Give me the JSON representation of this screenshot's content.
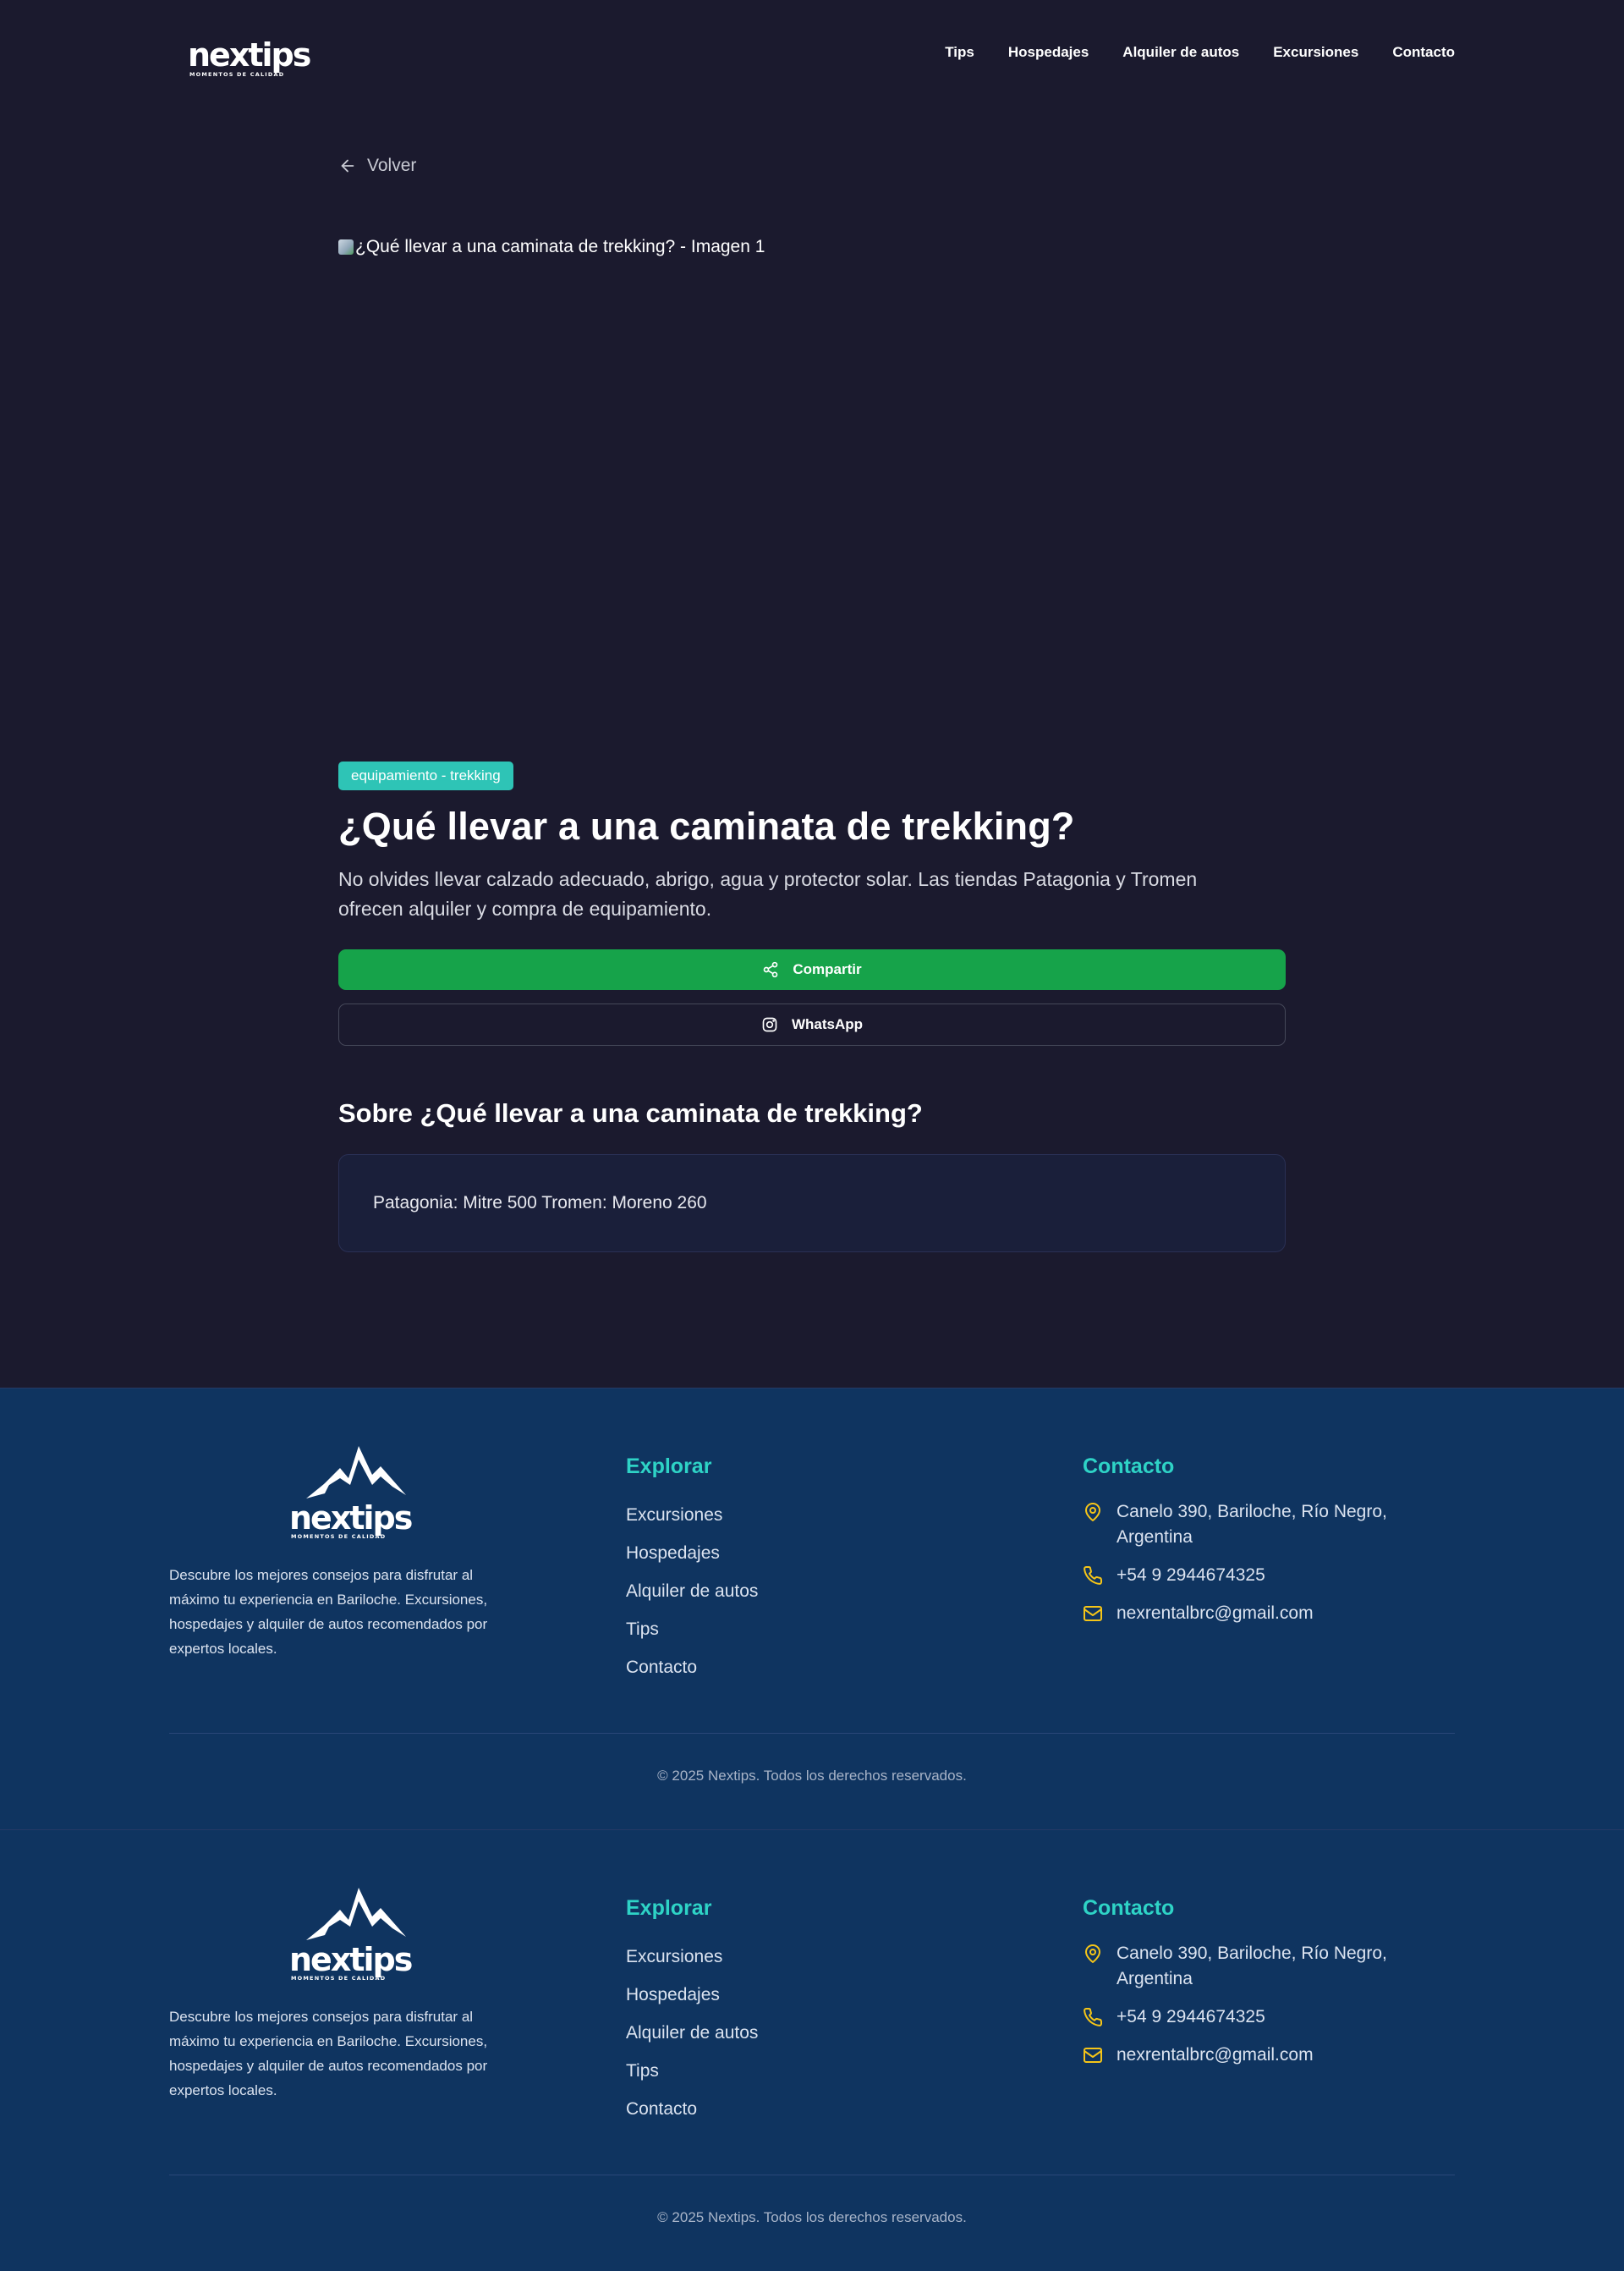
{
  "header": {
    "logo_alt": "nextips",
    "nav": [
      "Tips",
      "Hospedajes",
      "Alquiler de autos",
      "Excursiones",
      "Contacto"
    ]
  },
  "main": {
    "back_label": "Volver",
    "image_alt": "¿Qué llevar a una caminata de trekking? - Imagen 1",
    "tag": "equipamiento - trekking",
    "title": "¿Qué llevar a una caminata de trekking?",
    "description": "No olvides llevar calzado adecuado, abrigo, agua y protector solar. Las tiendas Patagonia y Tromen ofrecen alquiler y compra de equipamiento.",
    "share_label": "Compartir",
    "whatsapp_label": "WhatsApp",
    "about_title": "Sobre ¿Qué llevar a una caminata de trekking?",
    "about_text": "Patagonia: Mitre 500 Tromen: Moreno 260"
  },
  "footer": {
    "description": "Descubre los mejores consejos para disfrutar al máximo tu experiencia en Bariloche. Excursiones, hospedajes y alquiler de autos recomendados por expertos locales.",
    "explore_title": "Explorar",
    "explore_links": [
      "Excursiones",
      "Hospedajes",
      "Alquiler de autos",
      "Tips",
      "Contacto"
    ],
    "contact_title": "Contacto",
    "address": "Canelo 390, Bariloche, Río Negro, Argentina",
    "phone": "+54 9 2944674325",
    "email": "nexrentalbrc@gmail.com",
    "copyright": "© 2025 Nextips. Todos los derechos reservados."
  },
  "colors": {
    "background": "#1b1a2e",
    "footer": "#0f3460",
    "accent": "#2ec4b6",
    "share_green": "#16a34a",
    "icon_yellow": "#f5c518"
  },
  "icons": [
    "arrow-left-icon",
    "share-icon",
    "instagram-icon",
    "map-pin-icon",
    "phone-icon",
    "mail-icon",
    "mountain-icon"
  ]
}
